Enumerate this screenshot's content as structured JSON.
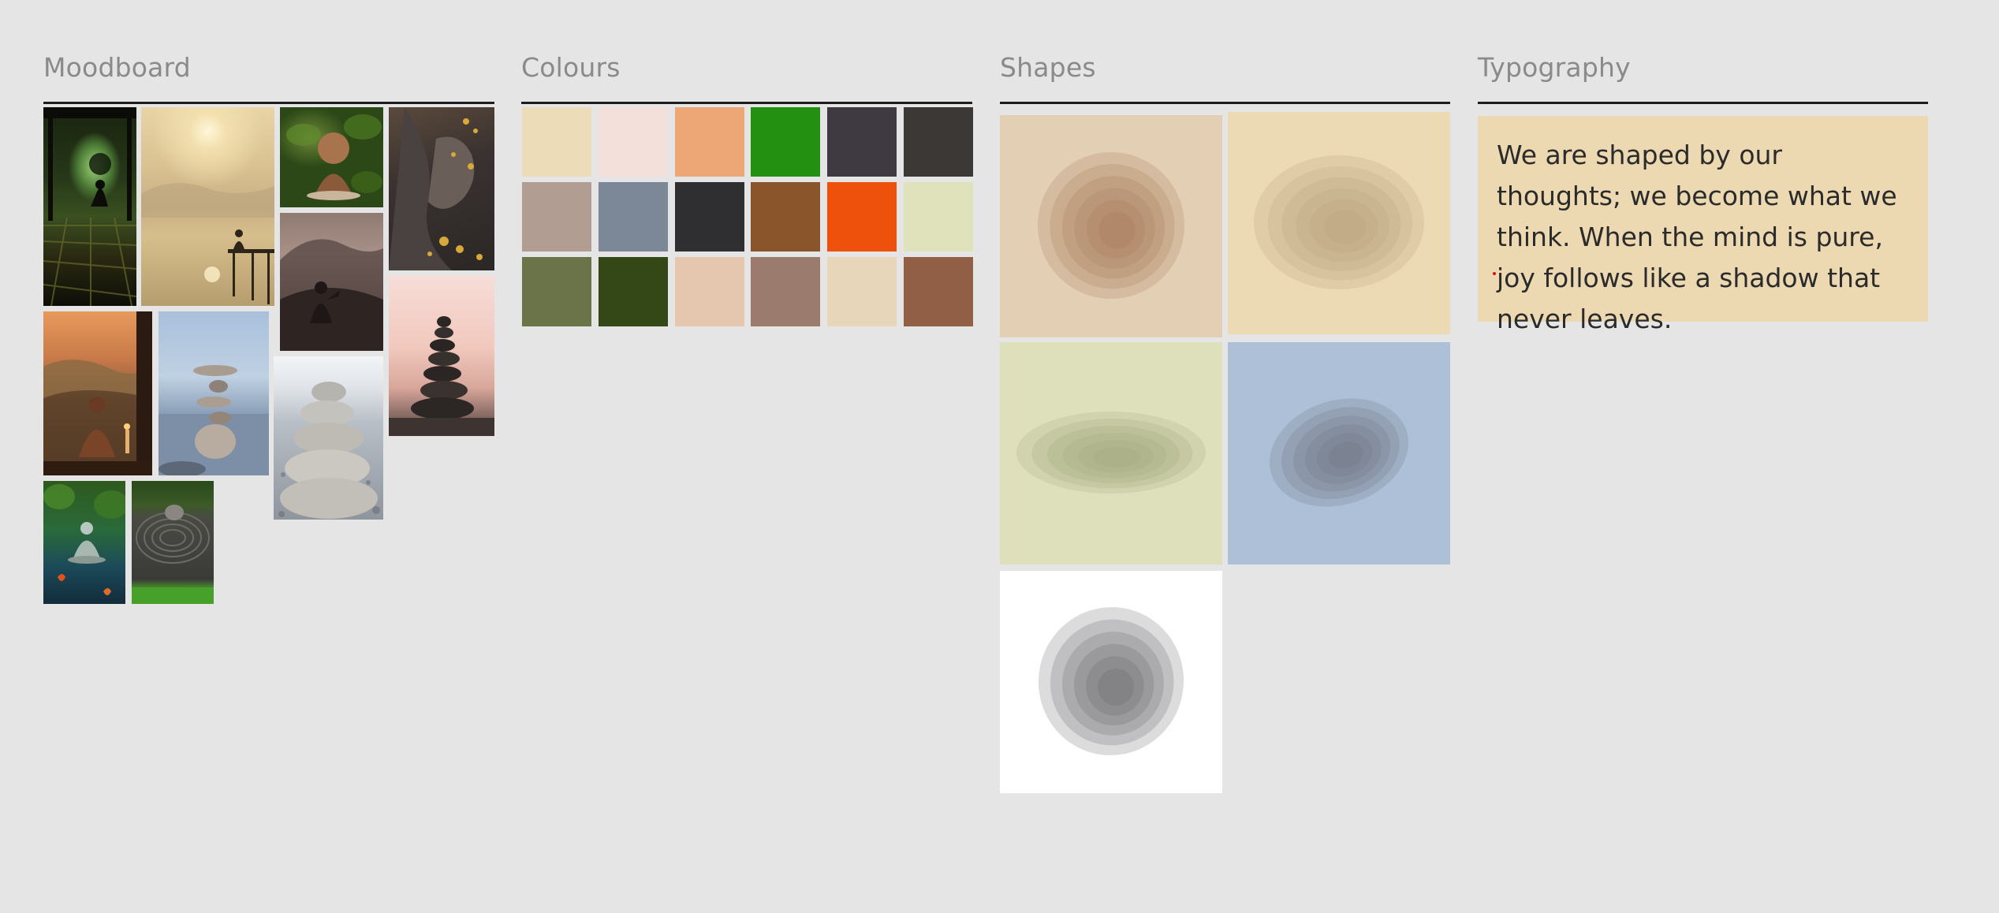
{
  "sections": {
    "moodboard": {
      "title": "Moodboard"
    },
    "colours": {
      "title": "Colours"
    },
    "shapes": {
      "title": "Shapes"
    },
    "typography": {
      "title": "Typography"
    }
  },
  "moodboard_images": [
    {
      "name": "meditation-porch-photo"
    },
    {
      "name": "misty-lake-pier-photo"
    },
    {
      "name": "smiling-monk-figurine-photo"
    },
    {
      "name": "golden-buddha-hand-photo"
    },
    {
      "name": "praying-silhouette-mountain-photo"
    },
    {
      "name": "buddha-statue-sunset-photo"
    },
    {
      "name": "balanced-stones-sea-photo"
    },
    {
      "name": "pebble-stack-photo"
    },
    {
      "name": "stone-tower-pink-sky-photo"
    },
    {
      "name": "buddha-pond-photo"
    },
    {
      "name": "zen-garden-photo"
    }
  ],
  "colours": [
    "#eddcb8",
    "#f4e0da",
    "#eda676",
    "#249011",
    "#3f3a42",
    "#3b3835",
    "#b29d92",
    "#7c8898",
    "#2f2f31",
    "#8a552a",
    "#ee510c",
    "#dfe2bb",
    "#6b7348",
    "#334816",
    "#e5c7b0",
    "#9a7b6d",
    "#e8d6ba",
    "#915f45"
  ],
  "shapes": [
    {
      "name": "shape-brown-concentric",
      "background": "#e3cfb4",
      "fill": "#a57556"
    },
    {
      "name": "shape-tan-concentric",
      "background": "#ecdab5",
      "fill": "#b8a079"
    },
    {
      "name": "shape-olive-concentric",
      "background": "#dee0bc",
      "fill": "#9ea27c"
    },
    {
      "name": "shape-blue-concentric",
      "background": "#adc0d7",
      "fill": "#6f7080"
    },
    {
      "name": "shape-grey-concentric",
      "background": "#ffffff",
      "fill": "#5f5e63"
    }
  ],
  "typography": {
    "sample_text": "We are shaped by our thoughts; we become what we think. When the mind is pure, joy follows like a shadow that never leaves."
  }
}
